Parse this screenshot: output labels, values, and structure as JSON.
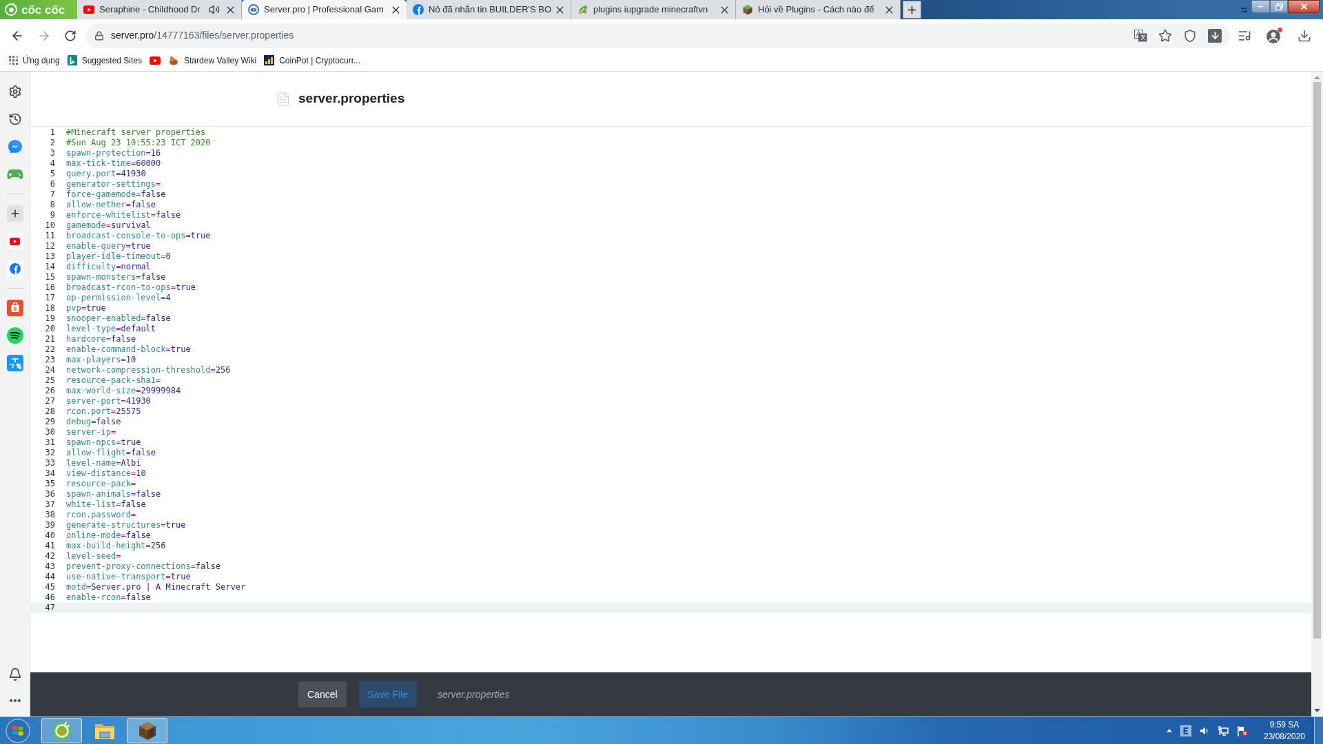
{
  "browser": {
    "brand": "cốc cốc",
    "tabs": [
      {
        "kind": "youtube",
        "title": "Seraphine - Childhood Dr",
        "audio": true,
        "selected": false
      },
      {
        "kind": "serverpro",
        "title": "Server.pro | Professional Gam",
        "audio": false,
        "selected": true
      },
      {
        "kind": "facebook",
        "title": "Nô đã nhắn tin BUILDER'S BO",
        "audio": false,
        "selected": false
      },
      {
        "kind": "leaf",
        "title": "plugins iupgrade minecraftvn",
        "audio": false,
        "selected": false
      },
      {
        "kind": "grass-block",
        "title": "Hỏi về Plugins - Cách nào để",
        "audio": false,
        "selected": false
      }
    ],
    "address": {
      "host": "server.pro",
      "path": "/14777163/files/server.properties"
    },
    "bookmarks": [
      {
        "kind": "apps",
        "label": "Ứng dụng"
      },
      {
        "kind": "bing",
        "label": "Suggested Sites"
      },
      {
        "kind": "youtube"
      },
      {
        "kind": "stardew",
        "label": "Stardew Valley Wiki"
      },
      {
        "kind": "coinpot",
        "label": "CoinPot | Cryptocurr..."
      }
    ]
  },
  "sidebar": {
    "items": [
      {
        "kind": "settings"
      },
      {
        "kind": "history"
      },
      {
        "kind": "messenger"
      },
      {
        "kind": "gamepad"
      },
      {
        "kind": "divider"
      },
      {
        "kind": "add"
      },
      {
        "kind": "youtube"
      },
      {
        "kind": "facebook"
      },
      {
        "kind": "divider"
      },
      {
        "kind": "shopee"
      },
      {
        "kind": "spotify"
      },
      {
        "kind": "tiki"
      }
    ],
    "bottom_items": [
      {
        "kind": "bell"
      },
      {
        "kind": "more"
      }
    ]
  },
  "editor": {
    "title": "server.properties",
    "lines": [
      {
        "number": "1",
        "comment": "#Minecraft server properties",
        "active": false
      },
      {
        "number": "2",
        "comment": "#Sun Aug 23 10:55:23 ICT 2020",
        "active": false
      },
      {
        "number": "3",
        "key": "spawn-protection",
        "operator": "=",
        "value": "16",
        "active": false
      },
      {
        "number": "4",
        "key": "max-tick-time",
        "operator": "=",
        "value": "60000",
        "active": false
      },
      {
        "number": "5",
        "key": "query.port",
        "operator": "=",
        "value": "41930",
        "active": false
      },
      {
        "number": "6",
        "key": "generator-settings",
        "operator": "=",
        "active": false
      },
      {
        "number": "7",
        "key": "force-gamemode",
        "operator": "=",
        "value": "false",
        "active": false
      },
      {
        "number": "8",
        "key": "allow-nether",
        "operator": "=",
        "value": "false",
        "active": false
      },
      {
        "number": "9",
        "key": "enforce-whitelist",
        "operator": "=",
        "value": "false",
        "active": false
      },
      {
        "number": "10",
        "key": "gamemode",
        "operator": "=",
        "value": "survival",
        "active": false
      },
      {
        "number": "11",
        "key": "broadcast-console-to-ops",
        "operator": "=",
        "value": "true",
        "active": false
      },
      {
        "number": "12",
        "key": "enable-query",
        "operator": "=",
        "value": "true",
        "active": false
      },
      {
        "number": "13",
        "key": "player-idle-timeout",
        "operator": "=",
        "value": "0",
        "active": false
      },
      {
        "number": "14",
        "key": "difficulty",
        "operator": "=",
        "value": "normal",
        "active": false
      },
      {
        "number": "15",
        "key": "spawn-monsters",
        "operator": "=",
        "value": "false",
        "active": false
      },
      {
        "number": "16",
        "key": "broadcast-rcon-to-ops",
        "operator": "=",
        "value": "true",
        "active": false
      },
      {
        "number": "17",
        "key": "op-permission-level",
        "operator": "=",
        "value": "4",
        "active": false
      },
      {
        "number": "18",
        "key": "pvp",
        "operator": "=",
        "value": "true",
        "active": false
      },
      {
        "number": "19",
        "key": "snooper-enabled",
        "operator": "=",
        "value": "false",
        "active": false
      },
      {
        "number": "20",
        "key": "level-type",
        "operator": "=",
        "value": "default",
        "active": false
      },
      {
        "number": "21",
        "key": "hardcore",
        "operator": "=",
        "value": "false",
        "active": false
      },
      {
        "number": "22",
        "key": "enable-command-block",
        "operator": "=",
        "value": "true",
        "active": false
      },
      {
        "number": "23",
        "key": "max-players",
        "operator": "=",
        "value": "10",
        "active": false
      },
      {
        "number": "24",
        "key": "network-compression-threshold",
        "operator": "=",
        "value": "256",
        "active": false
      },
      {
        "number": "25",
        "key": "resource-pack-sha1",
        "operator": "=",
        "active": false
      },
      {
        "number": "26",
        "key": "max-world-size",
        "operator": "=",
        "value": "29999984",
        "active": false
      },
      {
        "number": "27",
        "key": "server-port",
        "operator": "=",
        "value": "41930",
        "active": false
      },
      {
        "number": "28",
        "key": "rcon.port",
        "operator": "=",
        "value": "25575",
        "active": false
      },
      {
        "number": "29",
        "key": "debug",
        "operator": "=",
        "value": "false",
        "active": false
      },
      {
        "number": "30",
        "key": "server-ip",
        "operator": "=",
        "active": false
      },
      {
        "number": "31",
        "key": "spawn-npcs",
        "operator": "=",
        "value": "true",
        "active": false
      },
      {
        "number": "32",
        "key": "allow-flight",
        "operator": "=",
        "value": "false",
        "active": false
      },
      {
        "number": "33",
        "key": "level-name",
        "operator": "=",
        "value": "Albi",
        "active": false
      },
      {
        "number": "34",
        "key": "view-distance",
        "operator": "=",
        "value": "10",
        "active": false
      },
      {
        "number": "35",
        "key": "resource-pack",
        "operator": "=",
        "active": false
      },
      {
        "number": "36",
        "key": "spawn-animals",
        "operator": "=",
        "value": "false",
        "active": false
      },
      {
        "number": "37",
        "key": "white-list",
        "operator": "=",
        "value": "false",
        "active": false
      },
      {
        "number": "38",
        "key": "rcon.password",
        "operator": "=",
        "active": false
      },
      {
        "number": "39",
        "key": "generate-structures",
        "operator": "=",
        "value": "true",
        "active": false
      },
      {
        "number": "40",
        "key": "online-mode",
        "operator": "=",
        "value": "false",
        "active": false
      },
      {
        "number": "41",
        "key": "max-build-height",
        "operator": "=",
        "value": "256",
        "active": false
      },
      {
        "number": "42",
        "key": "level-seed",
        "operator": "=",
        "active": false
      },
      {
        "number": "43",
        "key": "prevent-proxy-connections",
        "operator": "=",
        "value": "false",
        "active": false
      },
      {
        "number": "44",
        "key": "use-native-transport",
        "operator": "=",
        "value": "true",
        "active": false
      },
      {
        "number": "45",
        "key": "motd",
        "operator": "=",
        "value": "Server.pro | A Minecraft Server",
        "active": false
      },
      {
        "number": "46",
        "key": "enable-rcon",
        "operator": "=",
        "value": "false",
        "active": false
      },
      {
        "number": "47",
        "active": true
      }
    ]
  },
  "footer": {
    "buttons": [
      {
        "label": "Cancel",
        "disabled": false
      },
      {
        "label": "Save File",
        "disabled": true
      }
    ],
    "filename": "server.properties"
  },
  "taskbar": {
    "apps": [
      {
        "kind": "coccoc",
        "open": true
      },
      {
        "kind": "explorer",
        "open": false
      },
      {
        "kind": "crate",
        "open": true
      }
    ],
    "tray": [
      {
        "kind": "show-hidden"
      },
      {
        "kind": "input-method"
      },
      {
        "kind": "volume"
      },
      {
        "kind": "network"
      },
      {
        "kind": "action-center"
      }
    ],
    "clock": {
      "time": "9:59 SA",
      "date": "23/08/2020"
    }
  }
}
